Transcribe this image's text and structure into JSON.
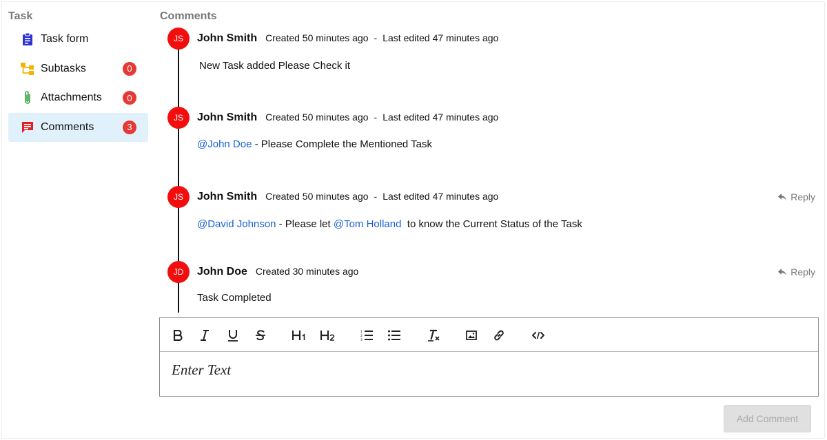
{
  "sidebar": {
    "title": "Task",
    "items": [
      {
        "label": "Task form",
        "icon": "clipboard-icon",
        "icon_color": "#2d33d6"
      },
      {
        "label": "Subtasks",
        "icon": "subtasks-icon",
        "icon_color": "#f5b301",
        "badge": "0"
      },
      {
        "label": "Attachments",
        "icon": "paperclip-icon",
        "icon_color": "#2e9d3a",
        "badge": "0"
      },
      {
        "label": "Comments",
        "icon": "comment-icon",
        "icon_color": "#e31e24",
        "badge": "3",
        "active": true
      }
    ]
  },
  "main": {
    "title": "Comments",
    "comments": [
      {
        "initials": "JS",
        "author": "John Smith",
        "created": "Created 50 minutes ago",
        "separator": "-",
        "edited": "Last edited 47 minutes ago",
        "body": {
          "text": "New Task added Please Check it"
        }
      },
      {
        "initials": "JS",
        "author": "John Smith",
        "created": "Created 50 minutes ago",
        "separator": "-",
        "edited": "Last edited 47 minutes ago",
        "body": {
          "mention1": "@John Doe",
          "text1": " - Please Complete the Mentioned Task"
        }
      },
      {
        "initials": "JS",
        "author": "John Smith",
        "created": "Created 50 minutes ago",
        "separator": "-",
        "edited": "Last edited 47 minutes ago",
        "reply": "Reply",
        "body": {
          "mention1": "@David Johnson",
          "text1": " - Please let ",
          "mention2": "@Tom Holland",
          "text2": "  to know the Current Status of the Task"
        }
      },
      {
        "initials": "JD",
        "author": "John Doe",
        "created": "Created 30 minutes ago",
        "reply": "Reply",
        "body": {
          "text": "Task Completed"
        }
      }
    ]
  },
  "editor": {
    "toolbar": [
      "bold",
      "italic",
      "underline",
      "strikethrough",
      "heading-1",
      "heading-2",
      "ordered-list",
      "bullet-list",
      "clear-format",
      "image",
      "link",
      "code"
    ],
    "placeholder": "Enter Text"
  },
  "add_comment_label": "Add Comment",
  "colors": {
    "avatar": "#f20e0e",
    "badge": "#e53935",
    "mention": "#1a5fd4",
    "active_nav_bg": "#e1f1fb"
  }
}
